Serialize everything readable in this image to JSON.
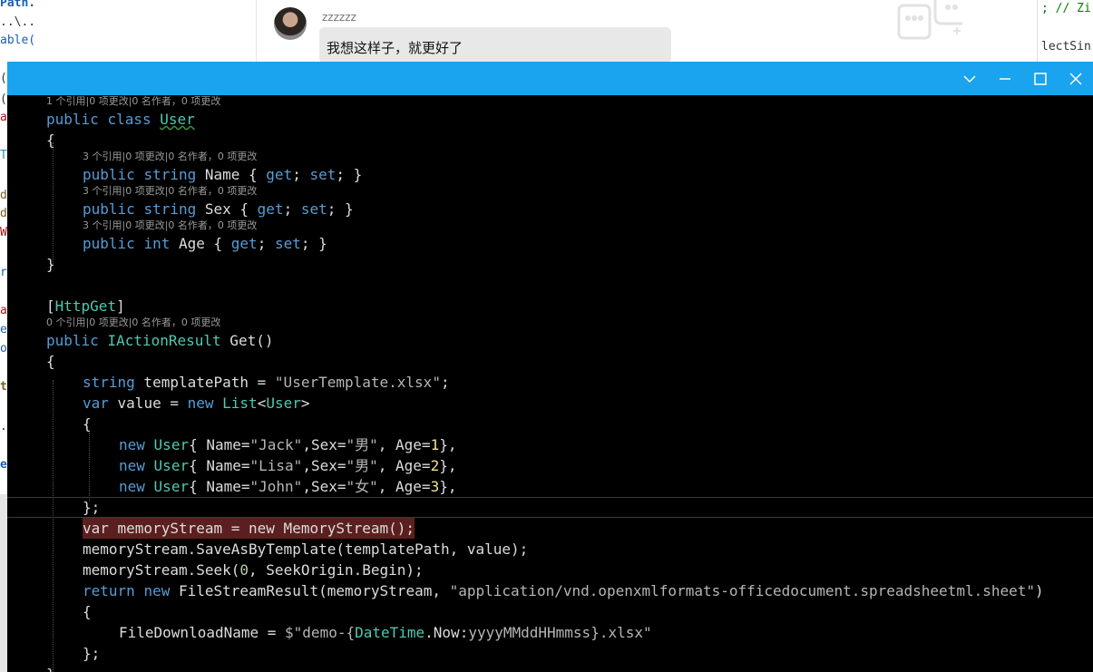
{
  "background": {
    "left_fragments": [
      "Path.",
      "..\\..",
      "able(",
      "(",
      "(",
      "a",
      "T",
      "d",
      "d",
      "W",
      "r",
      "a",
      "e",
      "o",
      "t",
      ".",
      "e"
    ],
    "right_fragments": [
      "; // Zi",
      "lectSin"
    ],
    "chat": {
      "username": "zzzzzz",
      "message": "我想这样子，就更好了"
    }
  },
  "window": {
    "title_buttons": [
      "chevron-down",
      "minimize",
      "maximize",
      "close"
    ]
  },
  "code": {
    "lens_class": "1 个引用|0 项更改|0 名作者，0 项更改",
    "lens_prop": "3 个引用|0 项更改|0 名作者，0 项更改",
    "lens_get": "0 个引用|0 项更改|0 名作者，0 项更改",
    "kw_public": "public",
    "kw_class": "class",
    "type_User": "User",
    "brace_open": "{",
    "brace_close": "}",
    "kw_string": "string",
    "kw_int": "int",
    "prop_Name": " Name { ",
    "prop_Sex": " Sex { ",
    "prop_Age": " Age { ",
    "kw_get": "get",
    "kw_set": "set",
    "semi_sp": "; ",
    "semi_close": "; }",
    "attr_open": "[",
    "attr_HttpGet": "HttpGet",
    "attr_close": "]",
    "type_IActionResult": "IActionResult",
    "method_Get": " Get()",
    "var_templatePath": " templatePath = ",
    "str_template": "\"UserTemplate.xlsx\"",
    "semi": ";",
    "kw_var": "var",
    "var_value": " value = ",
    "kw_new": "new",
    "type_List": " List",
    "lt": "<",
    "gt": ">",
    "init_name": "{ Name=",
    "str_jack": "\"Jack\"",
    "str_lisa": "\"Lisa\"",
    "str_john": "\"John\"",
    "sex_eq": ",Sex=",
    "str_male": "\"男\"",
    "str_female": "\"女\"",
    "age_eq": ", Age=",
    "num_1": "1",
    "num_2": "2",
    "num_3": "3",
    "close_comma": "},",
    "close_semi": "};",
    "line_memstream": "var memoryStream = new MemoryStream();",
    "line_saveas_a": "memoryStream.SaveAsByTemplate(",
    "line_saveas_b": "templatePath, value",
    "line_saveas_c": ");",
    "line_seek_a": "memoryStream.Seek(",
    "num_0": "0",
    "line_seek_b": ", SeekOrigin.Begin);",
    "kw_return": "return",
    "sp": " ",
    "type_FileStreamResult": "FileStreamResult",
    "fsr_args": "(memoryStream, ",
    "str_mime": "\"application/vnd.openxmlformats-officedocument.spreadsheetml.sheet\"",
    "paren_close": ")",
    "prop_FileDownloadName": "FileDownloadName = ",
    "interp_start": "$\"demo-{",
    "type_DateTime": "DateTime",
    "dot_now": ".Now:",
    "fmt": "yyyyMMddHHmmss",
    "interp_end": "}.xlsx\"",
    "last_brace": "}"
  },
  "colors": {
    "titlebar": "#1aa3ee",
    "editor_bg": "#000000",
    "keyword": "#569cd6",
    "type": "#4ec9b0",
    "string": "#b5b5b5",
    "number": "#b5cea8",
    "highlight": "#5c1f1f"
  }
}
